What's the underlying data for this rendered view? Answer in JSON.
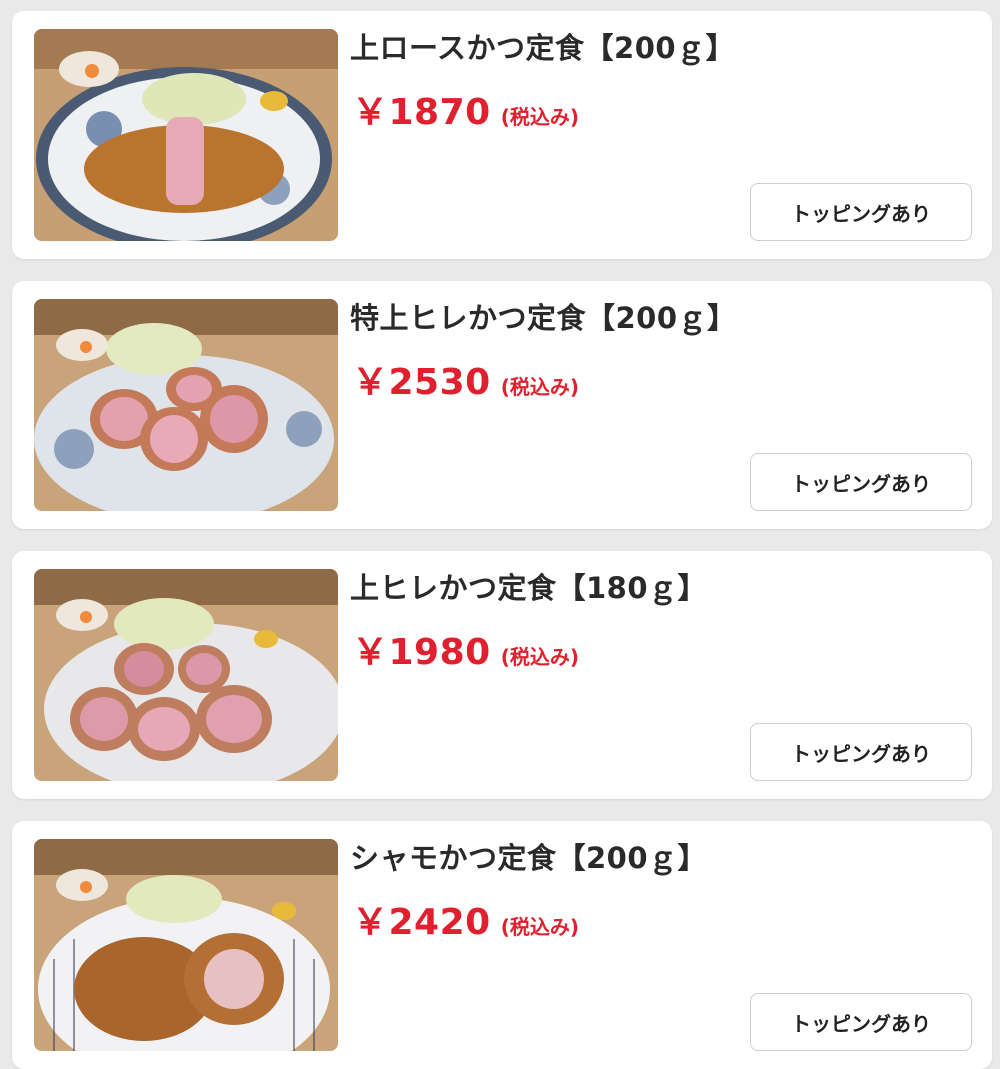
{
  "menu_items": [
    {
      "title": "上ロースかつ定食【200ｇ】",
      "price": "￥1870",
      "tax_note": "(税込み)",
      "topping_label": "トッピングあり",
      "image": "pork-loin-katsu-photo"
    },
    {
      "title": "特上ヒレかつ定食【200ｇ】",
      "price": "￥2530",
      "tax_note": "(税込み)",
      "topping_label": "トッピングあり",
      "image": "premium-fillet-katsu-photo"
    },
    {
      "title": "上ヒレかつ定食【180ｇ】",
      "price": "￥1980",
      "tax_note": "(税込み)",
      "topping_label": "トッピングあり",
      "image": "fillet-katsu-photo"
    },
    {
      "title": "シャモかつ定食【200ｇ】",
      "price": "￥2420",
      "tax_note": "(税込み)",
      "topping_label": "トッピングあり",
      "image": "shamo-chicken-katsu-photo"
    }
  ],
  "colors": {
    "price": "#e0202e",
    "background": "#e9e9ea",
    "card": "#ffffff"
  }
}
